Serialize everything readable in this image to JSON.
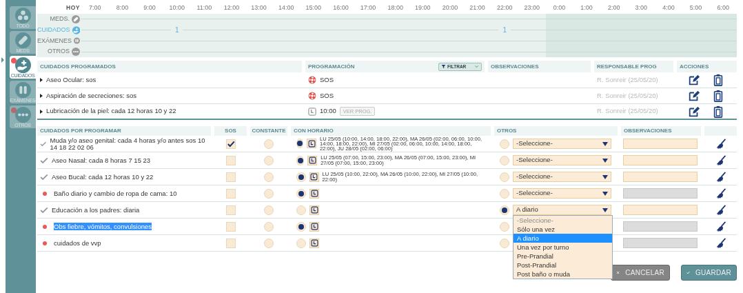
{
  "sidebar": {
    "items": [
      {
        "kind": "all",
        "label": "TODO",
        "selected": false,
        "badge": false
      },
      {
        "kind": "meds",
        "label": "MEDS",
        "selected": false,
        "badge": false
      },
      {
        "kind": "care",
        "label": "CUIDADOS",
        "selected": true,
        "badge": true
      },
      {
        "kind": "exams",
        "label": "EXÁMENES",
        "selected": false,
        "badge": false
      },
      {
        "kind": "others",
        "label": "OTROS",
        "selected": false,
        "badge": true
      }
    ]
  },
  "timeline": {
    "today_label": "HOY",
    "hours": [
      {
        "label": "7:00",
        "night": false
      },
      {
        "label": "8:00",
        "night": false
      },
      {
        "label": "9:00",
        "night": false
      },
      {
        "label": "10:00",
        "night": false,
        "counts": [
          {
            "kind": "care",
            "label": "1"
          }
        ]
      },
      {
        "label": "11:00",
        "night": false
      },
      {
        "label": "12:00",
        "night": false
      },
      {
        "label": "13:00",
        "night": false
      },
      {
        "label": "14:00",
        "night": false
      },
      {
        "label": "15:00",
        "night": false
      },
      {
        "label": "16:00",
        "night": false
      },
      {
        "label": "17:00",
        "night": false
      },
      {
        "label": "18:00",
        "night": false
      },
      {
        "label": "19:00",
        "night": false
      },
      {
        "label": "20:00",
        "night": false
      },
      {
        "label": "21:00",
        "night": false
      },
      {
        "label": "22:00",
        "night": false,
        "counts": [
          {
            "kind": "care",
            "label": "1"
          }
        ]
      },
      {
        "label": "23:00",
        "night": false
      },
      {
        "label": "0:00",
        "night": true
      },
      {
        "label": "1:00",
        "night": true
      },
      {
        "label": "2:00",
        "night": true
      },
      {
        "label": "3:00",
        "night": true
      },
      {
        "label": "4:00",
        "night": true
      },
      {
        "label": "5:00",
        "night": true
      },
      {
        "label": "6:00",
        "night": true
      }
    ],
    "rows": [
      {
        "kind": "meds",
        "label": "MEDS.",
        "highlighted": false
      },
      {
        "kind": "care",
        "label": "CUIDADOS",
        "highlighted": true
      },
      {
        "kind": "exams",
        "label": "EXÁMENES",
        "highlighted": false
      },
      {
        "kind": "others",
        "label": "OTROS",
        "highlighted": false
      }
    ]
  },
  "programmed": {
    "columns": [
      "CUIDADOS PROGRAMADOS",
      "PROGRAMACIÓN",
      "OBSERVACIONES",
      "RESPONSABLE PROG",
      "ACCIONES"
    ],
    "filter": {
      "label": "FILTRAR"
    },
    "rows": [
      {
        "name": "Aseo Ocular: sos",
        "schedule": {
          "kind": "sos",
          "text": "SOS"
        },
        "responsible": "R. Sonreir (25/05/20)"
      },
      {
        "name": "Aspiración de secreciones: sos",
        "schedule": {
          "kind": "sos",
          "text": "SOS"
        },
        "responsible": "R. Sonreir (25/05/20)"
      },
      {
        "name": "Lubricación de la piel: cada 12 horas 10 y 22",
        "schedule": {
          "kind": "time",
          "text": "10:00",
          "button": "VER PROG."
        },
        "responsible": "R. Sonreir (25/05/20)"
      }
    ]
  },
  "pending": {
    "columns": [
      "CUIDADOS POR PROGRAMAR",
      "SOS",
      "CONSTANTE",
      "CON HORARIO",
      "OTROS",
      "OBSERVACIONES"
    ],
    "rows": [
      {
        "done": true,
        "name": "Muda y/o aseo genital: cada 4 horas y/o antes sos 10 14 18 22 02 06",
        "highlighted": false,
        "sos_checked": true,
        "constant_selected": false,
        "scheduled_selected": true,
        "schedule": "LU 25/05 (10:00, 14:00, 18:00, 22:00), MA 26/05 (02:00, 06:00, 10:00, 14:00, 18:00, 22:00), MI 27/05 (02:00, 06:00, 10:00, 14:00, 18:00, 22:00), JU 28/05 (02:00, 06:00)",
        "other_selected": false,
        "other_value": "-Seleccione-",
        "observations_disabled": false
      },
      {
        "done": true,
        "name": "Aseo Nasal: cada 8 horas 7 15 23",
        "highlighted": false,
        "sos_checked": false,
        "constant_selected": false,
        "scheduled_selected": true,
        "schedule": "LU 25/05 (07:00, 15:00, 23:00), MA 26/05 (07:00, 15:00, 23:00), MI 27/05 (07:00, 15:00, 23:00)",
        "other_selected": false,
        "other_value": "-Seleccione-",
        "observations_disabled": false
      },
      {
        "done": true,
        "name": "Aseo Bucal: cada 12 horas 10 y 22",
        "highlighted": false,
        "sos_checked": false,
        "constant_selected": false,
        "scheduled_selected": true,
        "schedule": "LU 25/05 (10:00, 22:00), MA 26/05 (10:00, 22:00), MI 27/05 (10:00, 22:00)",
        "other_selected": false,
        "other_value": "-Seleccione-",
        "observations_disabled": false
      },
      {
        "done": false,
        "name": "Baño diario y cambio de ropa de cama: 10",
        "highlighted": false,
        "sos_checked": false,
        "constant_selected": false,
        "scheduled_selected": true,
        "other_selected": false,
        "other_value": "-Seleccione-",
        "observations_disabled": true
      },
      {
        "done": true,
        "name": "Educación a los padres: diaria",
        "highlighted": false,
        "sos_checked": false,
        "constant_selected": false,
        "scheduled_selected": false,
        "other_selected": true,
        "other_value": "A diario",
        "observations_disabled": false,
        "dropdown": {
          "options": [
            {
              "label": "-Seleccione-",
              "selected": false,
              "placeholder": true
            },
            {
              "label": "Sólo una vez",
              "selected": false
            },
            {
              "label": "A diario",
              "selected": true
            },
            {
              "label": "Una vez por turno",
              "selected": false
            },
            {
              "label": "Pre-Prandial",
              "selected": false
            },
            {
              "label": "Post-Prandial",
              "selected": false
            },
            {
              "label": "Post baño o muda",
              "selected": false
            }
          ]
        }
      },
      {
        "done": false,
        "name": "Obs fiebre, vómitos, convulsiones",
        "highlighted": true,
        "sos_checked": false,
        "constant_selected": false,
        "scheduled_selected": true,
        "other_selected": false,
        "observations_disabled": true
      },
      {
        "done": false,
        "name": "cuidados de vvp",
        "highlighted": false,
        "sos_checked": false,
        "constant_selected": false,
        "scheduled_selected": false,
        "other_selected": false,
        "observations_disabled": true
      }
    ]
  },
  "buttons": [
    {
      "kind": "cancel",
      "label": "CANCELAR"
    },
    {
      "kind": "save",
      "label": "GUARDAR"
    }
  ]
}
